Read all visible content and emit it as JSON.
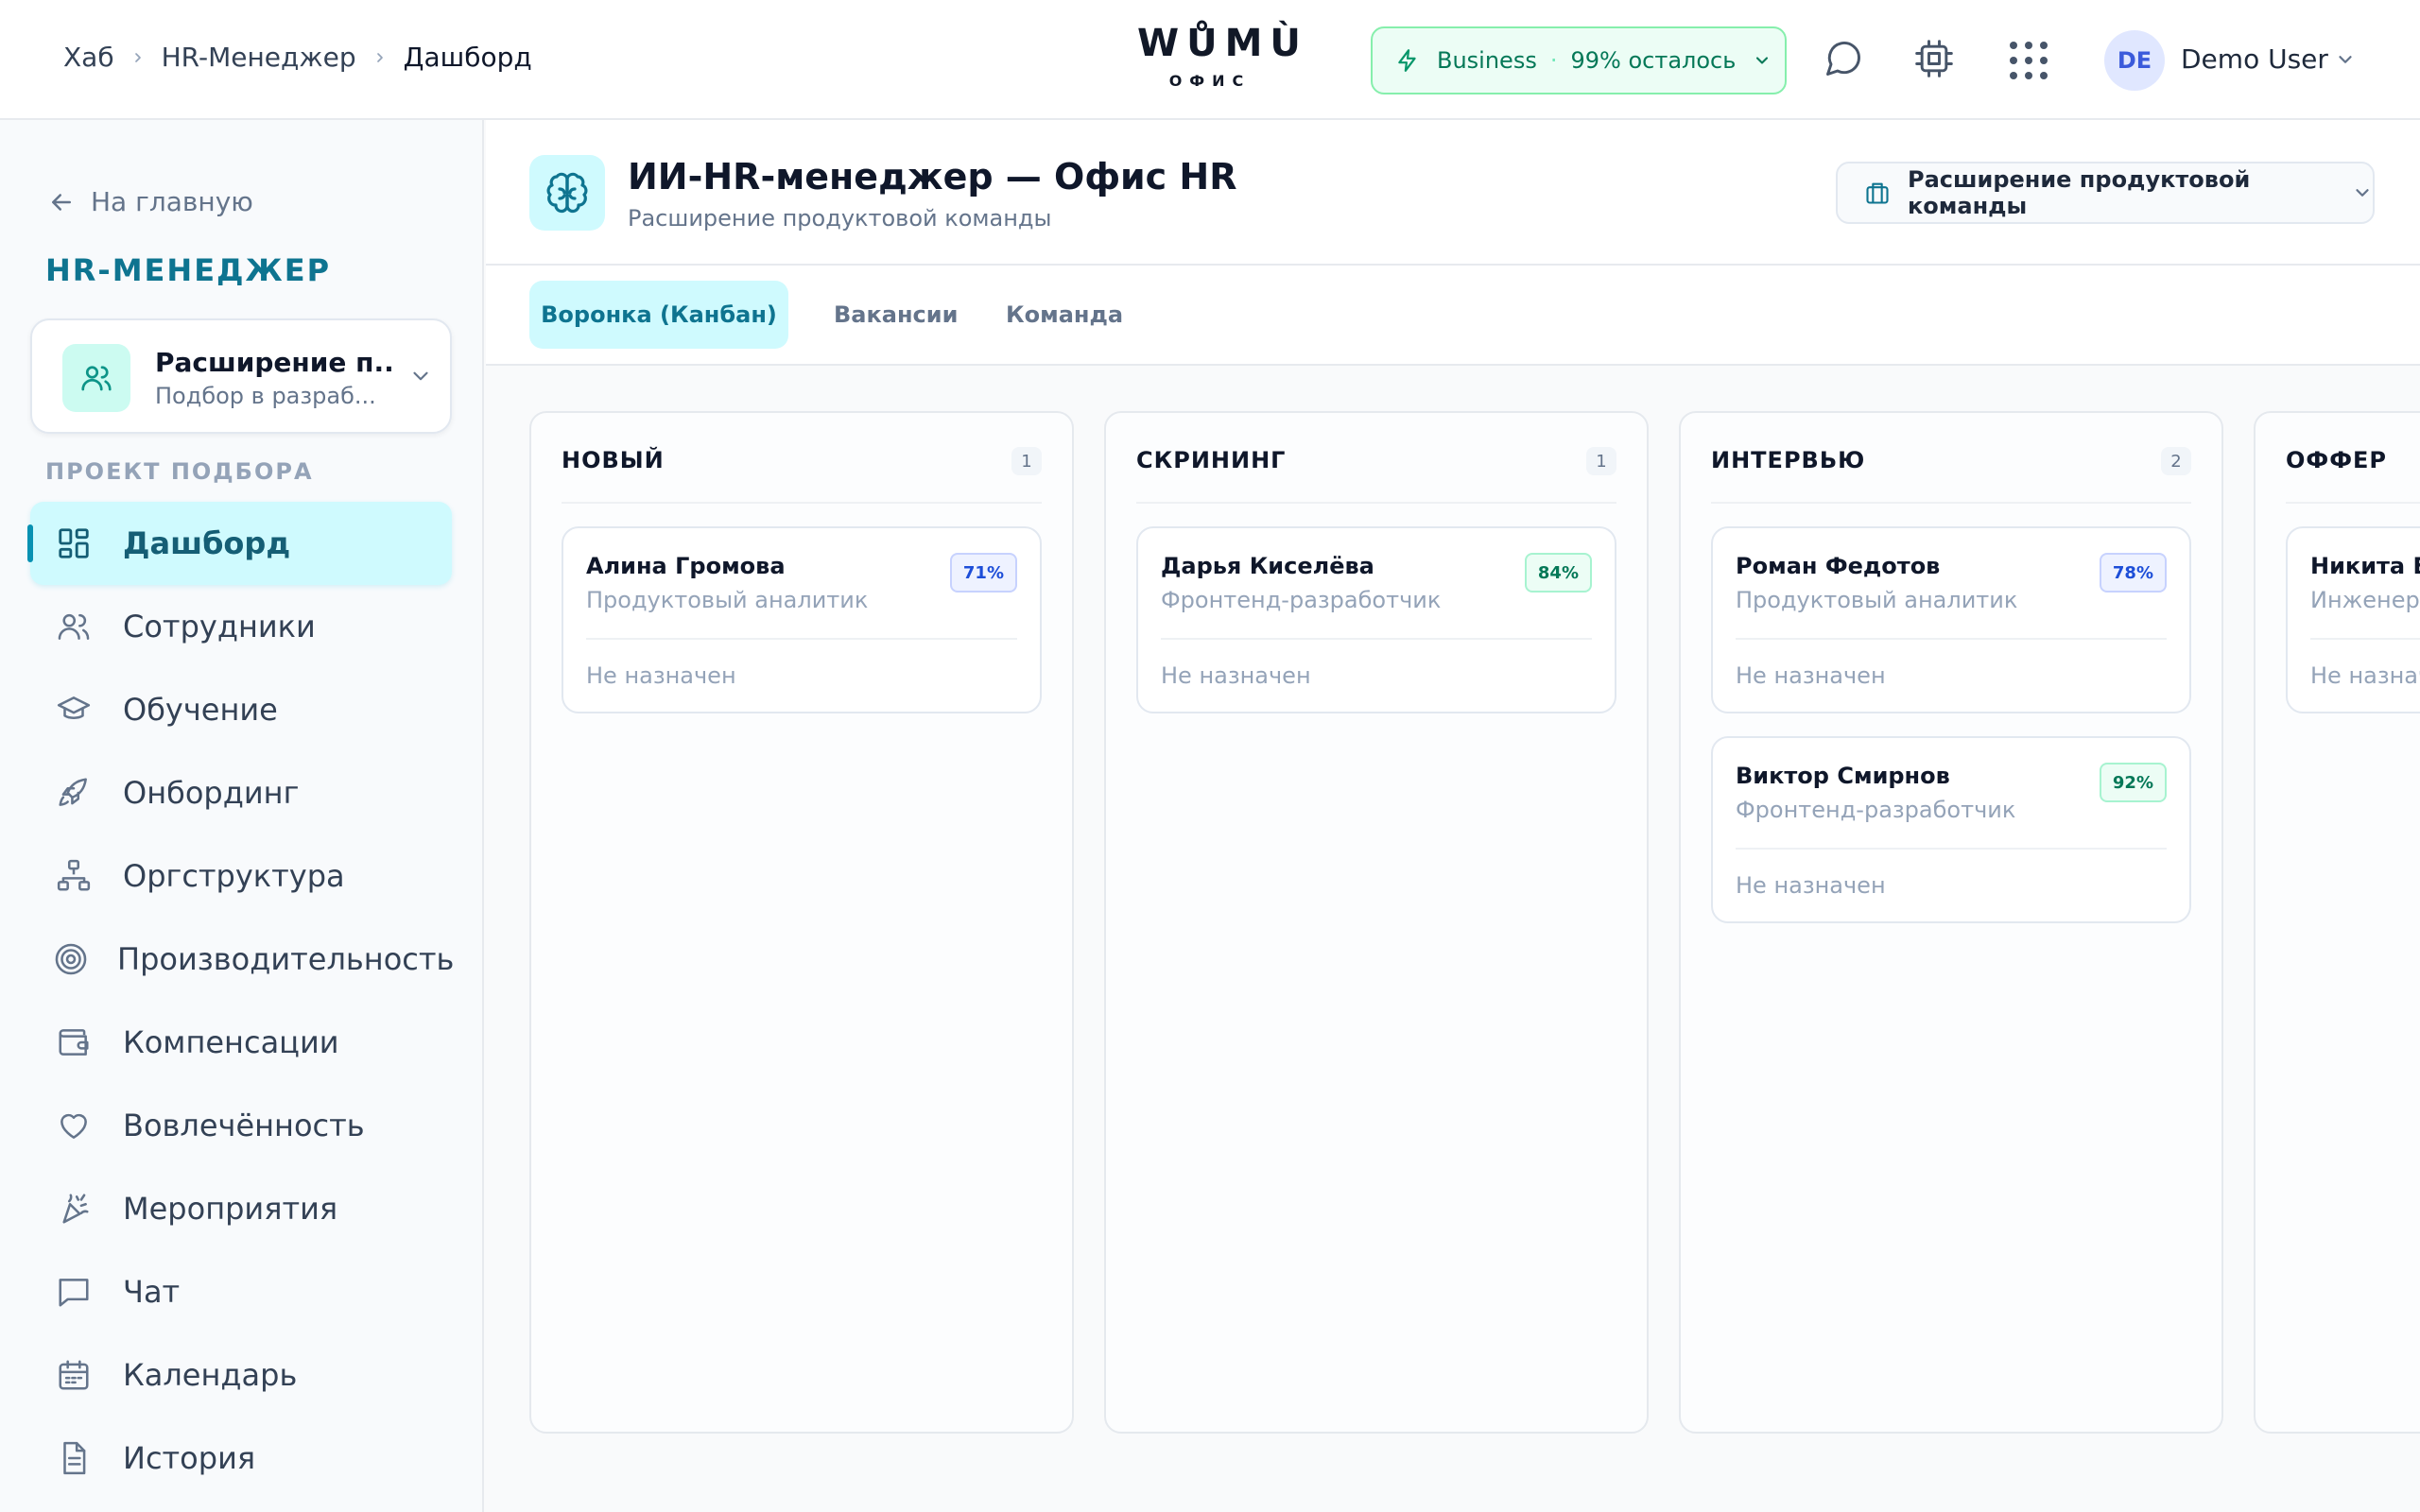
{
  "header": {
    "breadcrumbs": [
      "Хаб",
      "HR-Менеджер",
      "Дашборд"
    ],
    "logo": {
      "word": "WŮMÙ",
      "sub": "ОФИС"
    },
    "plan": {
      "name": "Business",
      "sep": "·",
      "remaining": "99% осталось"
    },
    "user": {
      "initials": "DE",
      "name": "Demo User"
    },
    "icons": [
      "bolt-icon",
      "chat-icon",
      "cpu-icon",
      "apps-grid-icon",
      "chevron-down-icon"
    ]
  },
  "sidebar": {
    "back_label": "На главную",
    "section_title": "HR-МЕНЕДЖЕР",
    "project": {
      "title": "Расширение п...",
      "subtitle": "Подбор в разраб..."
    },
    "subheading": "ПРОЕКТ ПОДБОРА",
    "items": [
      {
        "label": "Дашборд",
        "icon": "dashboard-icon",
        "active": true
      },
      {
        "label": "Сотрудники",
        "icon": "users-icon"
      },
      {
        "label": "Обучение",
        "icon": "graduation-cap-icon"
      },
      {
        "label": "Онбординг",
        "icon": "rocket-icon"
      },
      {
        "label": "Оргструктура",
        "icon": "org-chart-icon"
      },
      {
        "label": "Производительность",
        "icon": "target-icon"
      },
      {
        "label": "Компенсации",
        "icon": "wallet-icon"
      },
      {
        "label": "Вовлечённость",
        "icon": "heart-icon"
      },
      {
        "label": "Мероприятия",
        "icon": "party-popper-icon"
      },
      {
        "label": "Чат",
        "icon": "message-square-icon"
      },
      {
        "label": "Календарь",
        "icon": "calendar-icon"
      },
      {
        "label": "История",
        "icon": "document-icon"
      }
    ]
  },
  "main": {
    "title": "ИИ-HR-менеджер — Офис HR",
    "subtitle": "Расширение продуктовой команды",
    "team_select": "Расширение продуктовой команды",
    "tabs": [
      {
        "label": "Воронка (Канбан)",
        "active": true
      },
      {
        "label": "Вакансии"
      },
      {
        "label": "Команда"
      }
    ],
    "columns": [
      {
        "name": "НОВЫЙ",
        "count": "1",
        "cards": [
          {
            "name": "Алина Громова",
            "role": "Продуктовый аналитик",
            "score": "71%",
            "tone": "blue",
            "assignee": "Не назначен"
          }
        ]
      },
      {
        "name": "СКРИНИНГ",
        "count": "1",
        "cards": [
          {
            "name": "Дарья Киселёва",
            "role": "Фронтенд-разработчик",
            "score": "84%",
            "tone": "green",
            "assignee": "Не назначен"
          }
        ]
      },
      {
        "name": "ИНТЕРВЬЮ",
        "count": "2",
        "cards": [
          {
            "name": "Роман Федотов",
            "role": "Продуктовый аналитик",
            "score": "78%",
            "tone": "blue",
            "assignee": "Не назначен"
          },
          {
            "name": "Виктор Смирнов",
            "role": "Фронтенд-разработчик",
            "score": "92%",
            "tone": "green",
            "assignee": "Не назначен"
          }
        ]
      },
      {
        "name": "ОФФЕР",
        "count": "",
        "cards": [
          {
            "name": "Никита Бе",
            "role": "Инженер п",
            "score": "",
            "tone": "green",
            "assignee": "Не назнач"
          }
        ]
      }
    ]
  },
  "colors": {
    "accent": "#0891b2",
    "accent_bg": "#cffafe",
    "success": "#047857",
    "info": "#1d4ed8"
  }
}
